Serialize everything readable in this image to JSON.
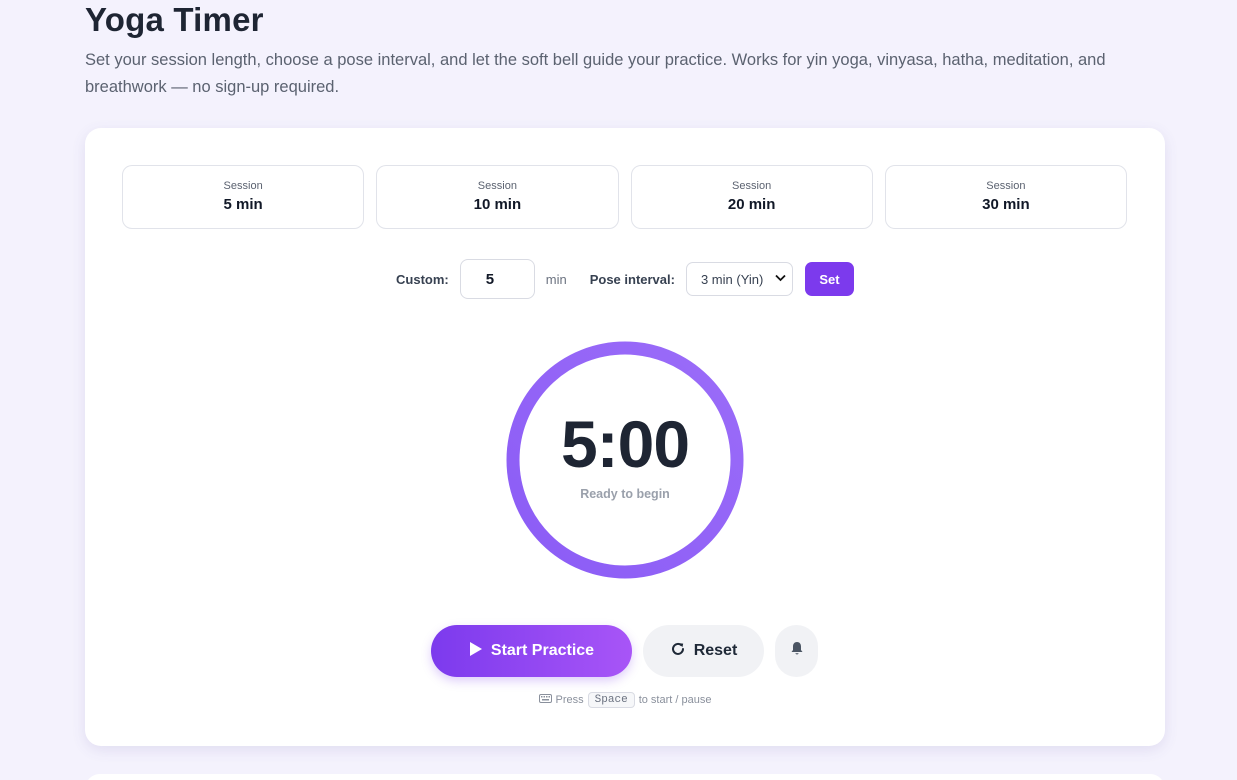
{
  "header": {
    "title": "Yoga Timer",
    "subtitle": "Set your session length, choose a pose interval, and let the soft bell guide your practice. Works for yin yoga, vinyasa, hatha, meditation, and breathwork — no sign-up required."
  },
  "presets": [
    {
      "label": "Session",
      "value": "5 min"
    },
    {
      "label": "Session",
      "value": "10 min"
    },
    {
      "label": "Session",
      "value": "20 min"
    },
    {
      "label": "Session",
      "value": "30 min"
    }
  ],
  "custom": {
    "label": "Custom:",
    "value": "5",
    "unit": "min",
    "interval_label": "Pose interval:",
    "interval_selected": "3 min (Yin)",
    "set_label": "Set"
  },
  "timer": {
    "time": "5:00",
    "status": "Ready to begin",
    "progress": 1.0
  },
  "controls": {
    "start_label": "Start Practice",
    "reset_label": "Reset"
  },
  "hint": {
    "prefix": "Press",
    "key": "Space",
    "suffix": "to start / pause"
  },
  "colors": {
    "accent": "#7c3aed",
    "accent_light": "#a855f7",
    "ring": "#8b5cf6",
    "background": "#f4f2fd"
  },
  "icons": {
    "start": "play-icon",
    "reset": "rotate-cw-icon",
    "bell": "bell-icon",
    "keyboard": "keyboard-icon"
  }
}
